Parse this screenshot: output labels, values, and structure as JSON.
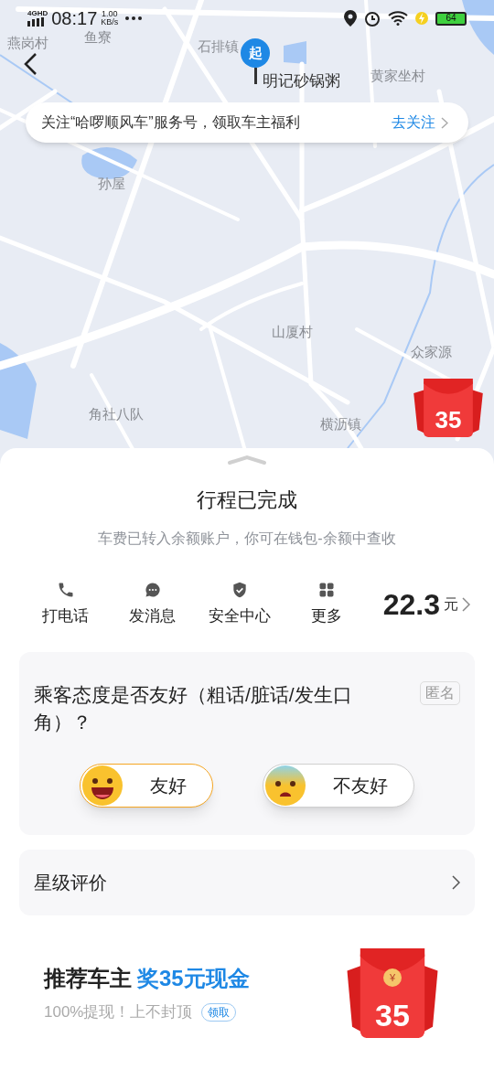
{
  "status_bar": {
    "network": "4GHD",
    "time": "08:17",
    "speed": "1.00",
    "speed_unit": "KB/s",
    "battery": "64"
  },
  "map": {
    "places": [
      {
        "name": "燕岗村",
        "kind": "place"
      },
      {
        "name": "鱼寮",
        "kind": "place"
      },
      {
        "name": "石排镇",
        "kind": "place"
      },
      {
        "name": "明记砂锅粥",
        "kind": "poi"
      },
      {
        "name": "黄家坐村",
        "kind": "place"
      },
      {
        "name": "孙屋",
        "kind": "place"
      },
      {
        "name": "山厦村",
        "kind": "place"
      },
      {
        "name": "众家源",
        "kind": "place"
      },
      {
        "name": "角社八队",
        "kind": "place"
      },
      {
        "name": "横沥镇",
        "kind": "place"
      }
    ],
    "start_marker": "起",
    "banner": {
      "text": "关注“哈啰顺风车”服务号，领取车主福利",
      "action": "去关注"
    },
    "red_packet": "35"
  },
  "trip": {
    "title": "行程已完成",
    "subtitle": "车费已转入余额账户，你可在钱包-余额中查收",
    "actions": [
      {
        "label": "打电话",
        "kind": "phone"
      },
      {
        "label": "发消息",
        "kind": "message"
      },
      {
        "label": "安全中心",
        "kind": "safety"
      },
      {
        "label": "更多",
        "kind": "more"
      }
    ],
    "fare": "22.3",
    "fare_unit": "元"
  },
  "question": {
    "text": "乘客态度是否友好（粗话/脏话/发生口角）？",
    "badge": "匿名",
    "options": [
      {
        "label": "友好",
        "kind": "happy",
        "selected": true
      },
      {
        "label": "不友好",
        "kind": "scared",
        "selected": false
      }
    ]
  },
  "rating": {
    "label": "星级评价"
  },
  "promo": {
    "title": "推荐车主",
    "highlight": "奖35元现金",
    "subtitle": "100%提现！上不封顶",
    "button": "领取",
    "coin": "¥",
    "amount": "35"
  }
}
